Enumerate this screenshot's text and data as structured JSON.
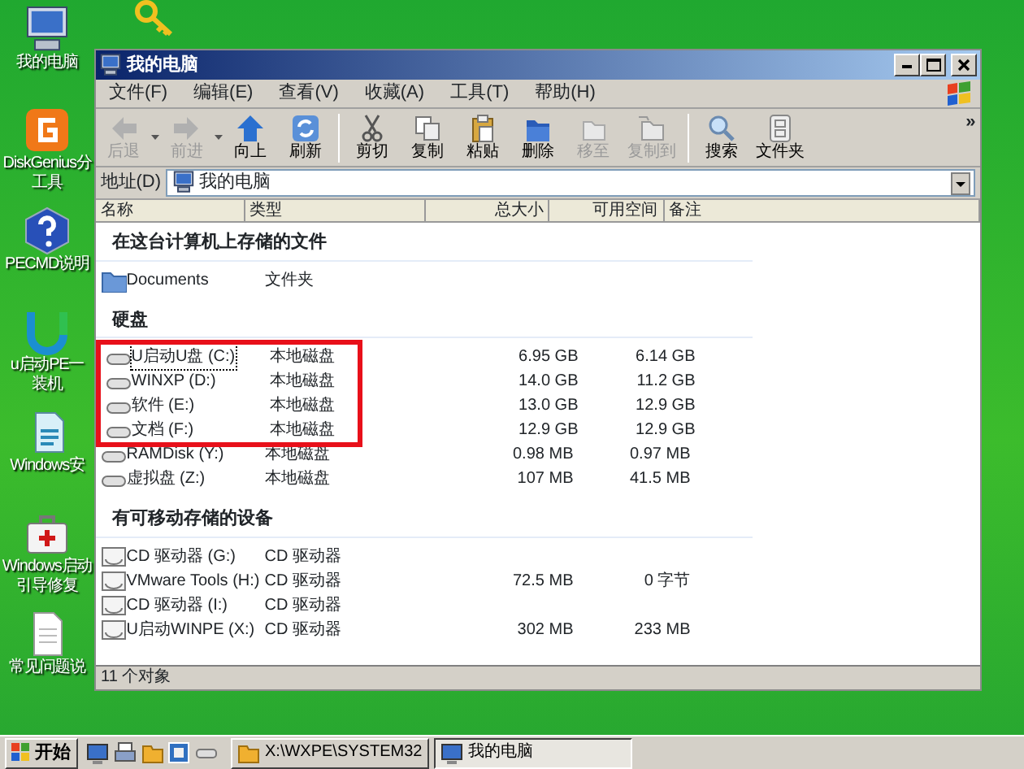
{
  "desktop_icons": [
    {
      "kind": "computer",
      "label": "我的电脑"
    },
    {
      "kind": "diskgenius",
      "label": "DiskGenius分",
      "label_2": "工具"
    },
    {
      "kind": "help",
      "label": "PECMD说明"
    },
    {
      "kind": "installer",
      "label": "u启动PE一",
      "label_2": "装机"
    },
    {
      "kind": "setup",
      "label": "Windows安"
    },
    {
      "kind": "repair",
      "label": "Windows启动",
      "label_2": "引导修复"
    },
    {
      "kind": "document",
      "label": "常见问题说"
    }
  ],
  "window": {
    "title": "我的电脑",
    "menu": [
      "文件(F)",
      "编辑(E)",
      "查看(V)",
      "收藏(A)",
      "工具(T)",
      "帮助(H)"
    ],
    "toolbar": [
      {
        "kind": "back",
        "label": "后退",
        "disabled": true,
        "dropdown": true
      },
      {
        "kind": "forward",
        "label": "前进",
        "disabled": true,
        "dropdown": true
      },
      {
        "kind": "up",
        "label": "向上",
        "disabled": false,
        "dropdown": false
      },
      {
        "kind": "refresh",
        "label": "刷新",
        "disabled": false,
        "dropdown": false,
        "separator_after": true
      },
      {
        "kind": "cut",
        "label": "剪切",
        "disabled": false,
        "dropdown": false
      },
      {
        "kind": "copy",
        "label": "复制",
        "disabled": false,
        "dropdown": false
      },
      {
        "kind": "paste",
        "label": "粘贴",
        "disabled": false,
        "dropdown": false
      },
      {
        "kind": "delete",
        "label": "删除",
        "disabled": false,
        "dropdown": false
      },
      {
        "kind": "move",
        "label": "移至",
        "disabled": true,
        "dropdown": false
      },
      {
        "kind": "copyto",
        "label": "复制到",
        "disabled": true,
        "dropdown": false,
        "separator_after": true
      },
      {
        "kind": "search",
        "label": "搜索",
        "disabled": false,
        "dropdown": false
      },
      {
        "kind": "folders",
        "label": "文件夹",
        "disabled": false,
        "dropdown": false
      }
    ],
    "toolbar_more": "»",
    "address": {
      "label": "地址(D)",
      "value": "我的电脑"
    },
    "columns": [
      "名称",
      "类型",
      "总大小",
      "可用空间",
      "备注"
    ],
    "sections": [
      {
        "title": "在这台计算机上存储的文件",
        "items": [
          {
            "kind": "folder",
            "name": "Documents",
            "type": "文件夹",
            "highlighted": false,
            "focused": false
          }
        ]
      },
      {
        "title": "硬盘",
        "items": [
          {
            "kind": "hdd",
            "name": "U启动U盘 (C:)",
            "type": "本地磁盘",
            "total": "6.95 GB",
            "free": "6.14 GB",
            "highlighted": true,
            "focused": true
          },
          {
            "kind": "hdd",
            "name": "WINXP (D:)",
            "type": "本地磁盘",
            "total": "14.0 GB",
            "free": "11.2 GB",
            "highlighted": true,
            "focused": false
          },
          {
            "kind": "hdd",
            "name": "软件 (E:)",
            "type": "本地磁盘",
            "total": "13.0 GB",
            "free": "12.9 GB",
            "highlighted": true,
            "focused": false
          },
          {
            "kind": "hdd",
            "name": "文档 (F:)",
            "type": "本地磁盘",
            "total": "12.9 GB",
            "free": "12.9 GB",
            "highlighted": true,
            "focused": false
          },
          {
            "kind": "hdd",
            "name": "RAMDisk (Y:)",
            "type": "本地磁盘",
            "total": "0.98 MB",
            "free": "0.97 MB",
            "highlighted": false,
            "focused": false
          },
          {
            "kind": "hdd",
            "name": "虚拟盘 (Z:)",
            "type": "本地磁盘",
            "total": "107 MB",
            "free": "41.5 MB",
            "highlighted": false,
            "focused": false
          }
        ]
      },
      {
        "title": "有可移动存储的设备",
        "items": [
          {
            "kind": "cd",
            "name": "CD 驱动器 (G:)",
            "type": "CD 驱动器",
            "highlighted": false,
            "focused": false
          },
          {
            "kind": "cd",
            "name": "VMware Tools (H:)",
            "type": "CD 驱动器",
            "total": "72.5 MB",
            "free": "0 字节",
            "highlighted": false,
            "focused": false
          },
          {
            "kind": "cd",
            "name": "CD 驱动器 (I:)",
            "type": "CD 驱动器",
            "highlighted": false,
            "focused": false
          },
          {
            "kind": "cd",
            "name": "U启动WINPE (X:)",
            "type": "CD 驱动器",
            "total": "302 MB",
            "free": "233 MB",
            "highlighted": false,
            "focused": false
          }
        ]
      }
    ],
    "status_bar": "11 个对象"
  },
  "taskbar": {
    "start": "开始",
    "quick_launch": [
      {
        "kind": "computer"
      },
      {
        "kind": "printer"
      },
      {
        "kind": "folder"
      },
      {
        "kind": "screen"
      },
      {
        "kind": "drive"
      }
    ],
    "tasks": [
      {
        "kind": "folder",
        "label": "X:\\WXPE\\SYSTEM32",
        "selected": false
      },
      {
        "kind": "computer",
        "label": "我的电脑",
        "selected": true
      }
    ]
  }
}
